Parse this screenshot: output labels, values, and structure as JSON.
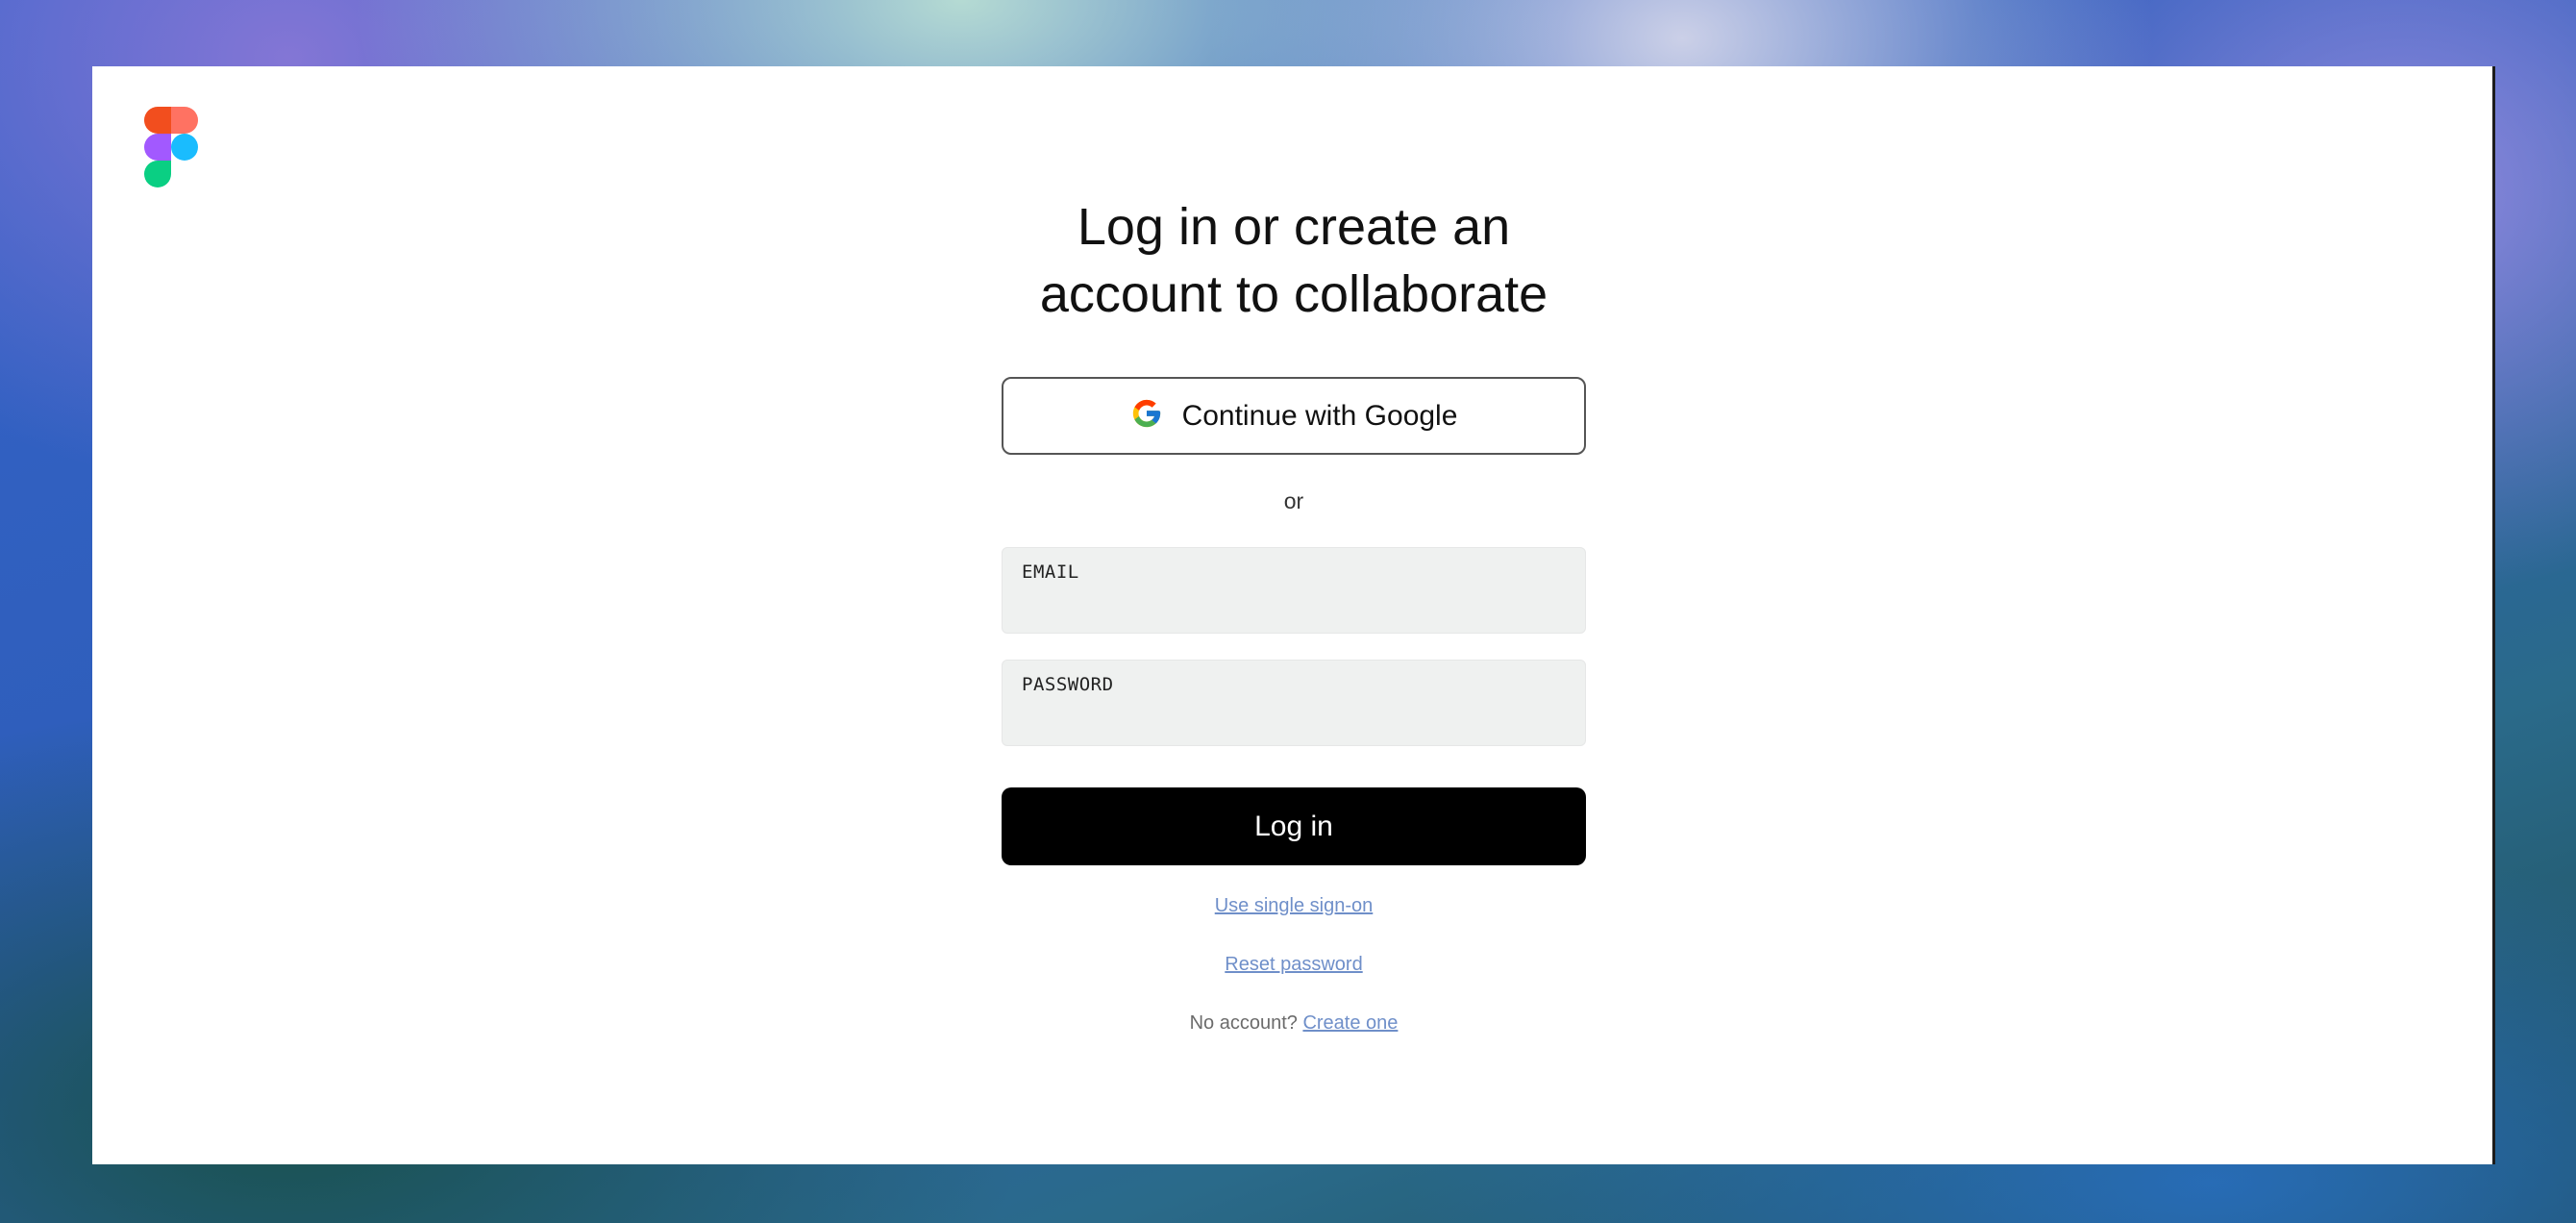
{
  "colors": {
    "login_button_bg": "#000000",
    "link": "#6f8fc9",
    "field_bg": "#eff1f0",
    "logo": [
      "#f24e1e",
      "#ff7262",
      "#a259ff",
      "#1abcfe",
      "#0acf83"
    ]
  },
  "header": {
    "logo_icon": "figma-logo-icon"
  },
  "form": {
    "title_line1": "Log in or create an",
    "title_line2": "account to collaborate",
    "google_button_label": "Continue with Google",
    "google_icon": "google-g-icon",
    "divider_text": "or",
    "email": {
      "label": "EMAIL",
      "value": "",
      "placeholder": ""
    },
    "password": {
      "label": "PASSWORD",
      "value": "",
      "placeholder": ""
    },
    "login_button_label": "Log in",
    "sso_link": "Use single sign-on",
    "reset_link": "Reset password",
    "no_account_text": "No account?",
    "create_link": "Create one"
  }
}
